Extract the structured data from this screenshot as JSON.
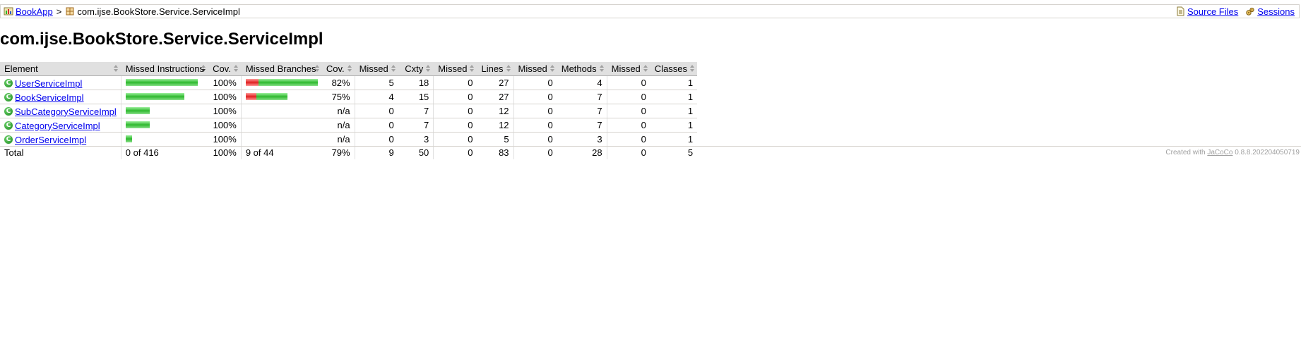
{
  "breadcrumb": {
    "root_label": "BookApp",
    "separator": ">",
    "current_label": "com.ijse.BookStore.Service.ServiceImpl",
    "source_files_label": "Source Files",
    "sessions_label": "Sessions"
  },
  "page": {
    "title": "com.ijse.BookStore.Service.ServiceImpl"
  },
  "table": {
    "headers": {
      "element": "Element",
      "missed_instructions": "Missed Instructions",
      "cov1": "Cov.",
      "missed_branches": "Missed Branches",
      "cov2": "Cov.",
      "missed1": "Missed",
      "cxty": "Cxty",
      "missed2": "Missed",
      "lines": "Lines",
      "missed3": "Missed",
      "methods": "Methods",
      "missed4": "Missed",
      "classes": "Classes"
    },
    "rows": [
      {
        "name": "UserServiceImpl",
        "instr_bar_fraction": 1.0,
        "instr_cov": "100%",
        "branch_missed_fraction": 0.18,
        "branch_covered_fraction": 0.82,
        "branch_cov": "82%",
        "cx_missed": "5",
        "cx_total": "18",
        "ln_missed": "0",
        "ln_total": "27",
        "me_missed": "0",
        "me_total": "4",
        "cl_missed": "0",
        "cl_total": "1"
      },
      {
        "name": "BookServiceImpl",
        "instr_bar_fraction": 0.81,
        "instr_cov": "100%",
        "branch_missed_fraction": 0.15,
        "branch_covered_fraction": 0.43,
        "branch_cov": "75%",
        "cx_missed": "4",
        "cx_total": "15",
        "ln_missed": "0",
        "ln_total": "27",
        "me_missed": "0",
        "me_total": "7",
        "cl_missed": "0",
        "cl_total": "1"
      },
      {
        "name": "SubCategoryServiceImpl",
        "instr_bar_fraction": 0.33,
        "instr_cov": "100%",
        "branch_missed_fraction": 0,
        "branch_covered_fraction": 0,
        "branch_cov": "n/a",
        "cx_missed": "0",
        "cx_total": "7",
        "ln_missed": "0",
        "ln_total": "12",
        "me_missed": "0",
        "me_total": "7",
        "cl_missed": "0",
        "cl_total": "1"
      },
      {
        "name": "CategoryServiceImpl",
        "instr_bar_fraction": 0.33,
        "instr_cov": "100%",
        "branch_missed_fraction": 0,
        "branch_covered_fraction": 0,
        "branch_cov": "n/a",
        "cx_missed": "0",
        "cx_total": "7",
        "ln_missed": "0",
        "ln_total": "12",
        "me_missed": "0",
        "me_total": "7",
        "cl_missed": "0",
        "cl_total": "1"
      },
      {
        "name": "OrderServiceImpl",
        "instr_bar_fraction": 0.09,
        "instr_cov": "100%",
        "branch_missed_fraction": 0,
        "branch_covered_fraction": 0,
        "branch_cov": "n/a",
        "cx_missed": "0",
        "cx_total": "3",
        "ln_missed": "0",
        "ln_total": "5",
        "me_missed": "0",
        "me_total": "3",
        "cl_missed": "0",
        "cl_total": "1"
      }
    ],
    "total": {
      "label": "Total",
      "instr": "0 of 416",
      "instr_cov": "100%",
      "branch": "9 of 44",
      "branch_cov": "79%",
      "cx_missed": "9",
      "cx_total": "50",
      "ln_missed": "0",
      "ln_total": "83",
      "me_missed": "0",
      "me_total": "28",
      "cl_missed": "0",
      "cl_total": "5"
    }
  },
  "footer": {
    "prefix": "Created with",
    "link": "JaCoCo",
    "version": "0.8.8.202204050719"
  },
  "colors": {
    "covered": "#2eb82e",
    "missed": "#e02020",
    "header_bg": "#e0e0e0"
  }
}
